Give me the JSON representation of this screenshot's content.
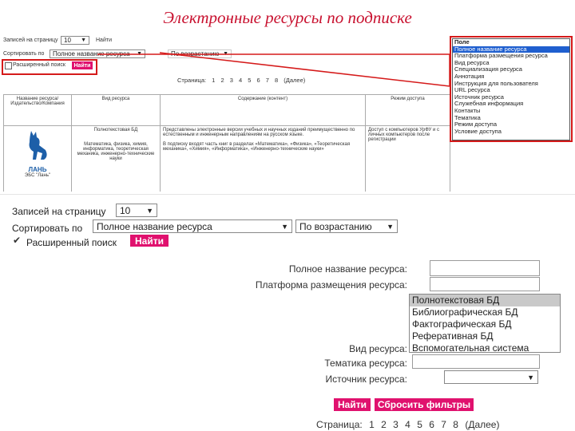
{
  "title": "Электронные ресурсы по подписке",
  "small": {
    "per_page_label": "Записей на страницу",
    "per_page_value": "10",
    "go_label": "Найти",
    "sort_label": "Сортировать по",
    "sort_value": "Полное название ресурса",
    "order_value": "По возрастанию",
    "advanced_label": "Расширенный поиск",
    "find_button": "Найти",
    "pager_label": "Страница:",
    "pages": [
      "1",
      "2",
      "3",
      "4",
      "5",
      "6",
      "7",
      "8"
    ],
    "next_label": "(Далее)",
    "table": {
      "headers": [
        "Название ресурса/Издательство/Компания",
        "Вид ресурса",
        "Содержание (контент)",
        "Режим доступа"
      ],
      "logo_text": "ЛАНЬ",
      "logo_caption": "ЭБС \"Лань\"",
      "type": "Полнотекстовая БД",
      "type_detail": "Математика, физика, химия, информатика, теоретическая механика, инженерно-технические науки",
      "content": "Представлены электронные версии учебных и научных изданий преимущественно по естественным и инженерным направлениям на русском языке.",
      "content2": "В подписку входят часть книг в разделах «Математика», «Физика», «Теоретическая механика», «Химия», «Информатика», «Инженерно-технические науки»",
      "access": "Доступ с компьютеров УрФУ и с личных компьютеров после регистрации"
    },
    "dropdown_header": "Поле",
    "dropdown_items": [
      "Полное название ресурса",
      "Платформа размещения ресурса",
      "Вид ресурса",
      "Специализация ресурса",
      "Аннотация",
      "Инструкция для пользователя",
      "URL ресурса",
      "Источник ресурса",
      "Служебная информация",
      "Контакты",
      "Тематика",
      "Режим доступа",
      "Условие доступа"
    ]
  },
  "big": {
    "per_page_label": "Записей на страницу",
    "per_page_value": "10",
    "sort_label": "Сортировать по",
    "sort_value": "Полное название ресурса",
    "order_value": "По возрастанию",
    "advanced_label": "Расширенный поиск",
    "advanced_button": "Найти",
    "fields": {
      "full_name": "Полное название ресурса:",
      "platform": "Платформа размещения ресурса:",
      "type": "Вид ресурса:",
      "topic": "Тематика ресурса:",
      "source": "Источник ресурса:"
    },
    "type_options": [
      "Полнотекстовая БД",
      "Библиографическая БД",
      "Фактографическая БД",
      "Реферативная БД",
      "Вспомогательная система"
    ],
    "find_button": "Найти",
    "reset_button": "Сбросить фильтры",
    "pager_label": "Страница:",
    "pages": [
      "1",
      "2",
      "3",
      "4",
      "5",
      "6",
      "7",
      "8"
    ],
    "next_label": "(Далее)"
  },
  "colors": {
    "accent": "#e0116e",
    "title": "#c8102e",
    "highlight": "#d51a1a",
    "list_selected": "#1f5fcf"
  }
}
